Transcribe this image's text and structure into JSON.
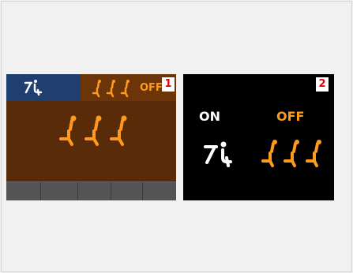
{
  "panel1": {
    "badge": "1",
    "status_off": "OFF",
    "icons": {
      "left": "driver-seat-icon",
      "small_row": "passenger-seats-icon",
      "big_row": "passenger-seats-large-icon"
    }
  },
  "panel2": {
    "badge": "2",
    "on_label": "ON",
    "off_label": "OFF",
    "icons": {
      "on": "seat-icon",
      "off": "passenger-seats-icon"
    }
  },
  "colors": {
    "orange": "#ff9b1a",
    "panel1_bg": "#5a2b09",
    "panel1_blue": "#1f3f71",
    "panel2_bg": "#000000",
    "badge_red": "#e10000"
  }
}
